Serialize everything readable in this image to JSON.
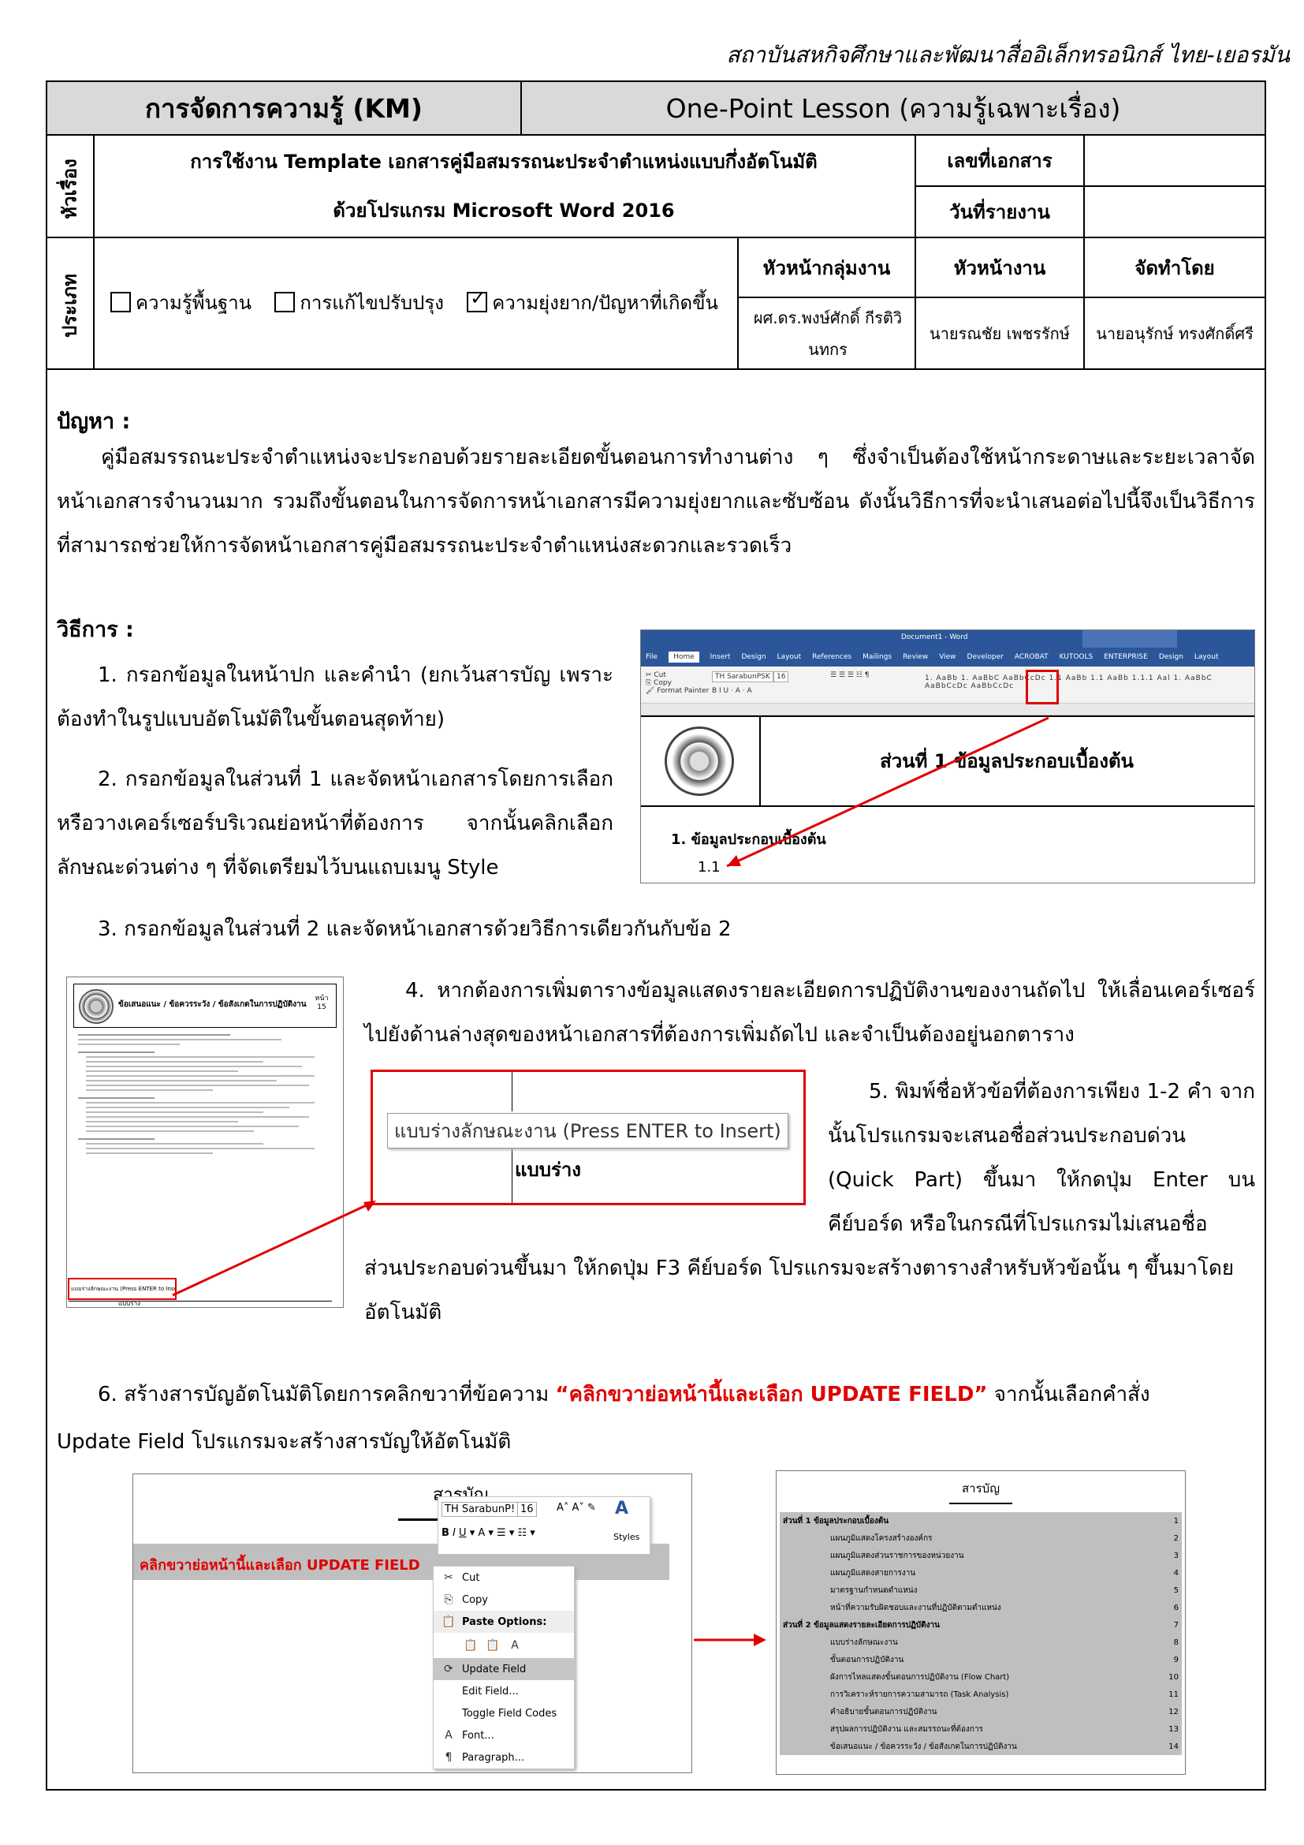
{
  "institute": "สถาบันสหกิจศึกษาและพัฒนาสื่ออิเล็กทรอนิกส์ ไทย-เยอรมัน",
  "header": {
    "km": "การจัดการความรู้ (KM)",
    "opl": "One-Point Lesson  (ความรู้เฉพาะเรื่อง)"
  },
  "topic": {
    "label": "หัวเรื่อง",
    "line1": "การใช้งาน Template เอกสารคู่มือสมรรถนะประจำตำแหน่งแบบกึ่งอัตโนมัติ",
    "line2": "ด้วยโปรแกรม Microsoft Word 2016",
    "doc_no_label": "เลขที่เอกสาร",
    "doc_no_value": "",
    "report_date_label": "วันที่รายงาน",
    "report_date_value": ""
  },
  "type": {
    "label": "ประเภท",
    "options": [
      {
        "label": "ความรู้พื้นฐาน",
        "checked": false
      },
      {
        "label": "การแก้ไขปรับปรุง",
        "checked": false
      },
      {
        "label": "ความยุ่งยาก/ปัญหาที่เกิดขึ้น",
        "checked": true
      }
    ],
    "col_heads": [
      "หัวหน้ากลุ่มงาน",
      "หัวหน้างาน",
      "จัดทำโดย"
    ],
    "names": [
      "ผศ.ดร.พงษ์ศักดิ์ กีรติวินทกร",
      "นายรณชัย เพชรรักษ์",
      "นายอนุรักษ์ ทรงศักดิ์ศรี"
    ]
  },
  "problem": {
    "heading": "ปัญหา :",
    "text": "คู่มือสมรรถนะประจำตำแหน่งจะประกอบด้วยรายละเอียดขั้นตอนการทำงานต่าง ๆ ซึ่งจำเป็นต้องใช้หน้ากระดาษและระยะเวลาจัดหน้าเอกสารจำนวนมาก รวมถึงขั้นตอนในการจัดการหน้าเอกสารมีความยุ่งยากและซับซ้อน ดังนั้นวิธีการที่จะนำเสนอต่อไปนี้จึงเป็นวิธีการที่สามารถช่วยให้การจัดหน้าเอกสารคู่มือสมรรถนะประจำตำแหน่งสะดวกและรวดเร็ว"
  },
  "method": {
    "heading": "วิธีการ :",
    "step1": "1.  กรอกข้อมูลในหน้าปก และคำนำ (ยกเว้นสารบัญ เพราะต้องทำในรูปแบบอัตโนมัติในขั้นตอนสุดท้าย)",
    "step2": "2.  กรอกข้อมูลในส่วนที่ 1 และจัดหน้าเอกสารโดยการเลือกหรือวางเคอร์เซอร์บริเวณย่อหน้าที่ต้องการ จากนั้นคลิกเลือกลักษณะด่วนต่าง ๆ ที่จัดเตรียมไว้บนแถบเมนู Style",
    "step3": "3.  กรอกข้อมูลในส่วนที่ 2 และจัดหน้าเอกสารด้วยวิธีการเดียวกันกับข้อ 2",
    "step4": "4.  หากต้องการเพิ่มตารางข้อมูลแสดงรายละเอียดการปฏิบัติงานของงานถัดไป ให้เลื่อนเคอร์เซอร์ไปยังด้านล่างสุดของหน้าเอกสารที่ต้องการเพิ่มถัดไป และจำเป็นต้องอยู่นอกตาราง",
    "step5a": "5.  พิมพ์ชื่อหัวข้อที่ต้องการเพียง 1-2 คำ จากนั้นโปรแกรมจะเสนอชื่อส่วนประกอบด่วน (Quick Part) ขึ้นมา ให้กดปุ่ม Enter บนคีย์บอร์ด หรือในกรณีที่โปรแกรมไม่เสนอชื่อ",
    "step5b": "ส่วนประกอบด่วนขึ้นมา ให้กดปุ่ม F3 คีย์บอร์ด โปรแกรมจะสร้างตารางสำหรับหัวข้อนั้น ๆ ขึ้นมาโดยอัตโนมัติ",
    "step6_pre": "6.  สร้างสารบัญอัตโนมัติโดยการคลิกขวาที่ข้อความ ",
    "step6_red": "“คลิกขวาย่อหน้านี้และเลือก UPDATE FIELD”",
    "step6_post": " จากนั้นเลือกคำสั่ง",
    "step6_line2": "Update Field โปรแกรมจะสร้างสารบัญให้อัตโนมัติ"
  },
  "shot1": {
    "title_bar": "Document1 - Word",
    "tabs": [
      "File",
      "Home",
      "Insert",
      "Design",
      "Layout",
      "References",
      "Mailings",
      "Review",
      "View",
      "Developer",
      "ACROBAT",
      "KUTOOLS",
      "ENTERPRISE",
      "Design",
      "Layout"
    ],
    "font": "TH SarabunPSK",
    "size": "16",
    "part_title": "ส่วนที่ 1  ข้อมูลประกอบเบื้องต้น",
    "heading1": "1.  ข้อมูลประกอบเบื้องต้น",
    "heading2": "1.1",
    "accent": "#e00000"
  },
  "shot2": {
    "title": "ข้อเสนอแนะ / ข้อควรระวัง / ข้อสังเกตในการปฏิบัติงาน",
    "page": "หน้า 15",
    "note": "แบบร่างลักษณะงาน (Press ENTER to Insert)",
    "typed": "แบบร่าง"
  },
  "shot3": {
    "popup": "แบบร่างลักษณะงาน  (Press ENTER to Insert)",
    "typed": "แบบร่าง"
  },
  "shot4": {
    "toc_title": "สารบัญ",
    "field_text": "คลิกขวาย่อหน้านี้และเลือก UPDATE FIELD",
    "font": "TH SarabunP!",
    "size": "16",
    "styles": "Styles",
    "menu": [
      "Cut",
      "Copy",
      "Paste Options:",
      "Update Field",
      "Edit Field...",
      "Toggle Field Codes",
      "Font...",
      "Paragraph..."
    ]
  },
  "shot5": {
    "toc_title": "สารบัญ",
    "rows": [
      {
        "t": "ส่วนที่ 1 ข้อมูลประกอบเบื้องต้น",
        "p": "1",
        "b": true
      },
      {
        "t": "แผนภูมิแสดงโครงสร้างองค์กร",
        "p": "2",
        "b": false
      },
      {
        "t": "แผนภูมิแสดงส่วนราชการของหน่วยงาน",
        "p": "3",
        "b": false
      },
      {
        "t": "แผนภูมิแสดงสายการงาน",
        "p": "4",
        "b": false
      },
      {
        "t": "มาตรฐานกำหนดตำแหน่ง",
        "p": "5",
        "b": false
      },
      {
        "t": "หน้าที่ความรับผิดชอบและงานที่ปฏิบัติตามตำแหน่ง",
        "p": "6",
        "b": false
      },
      {
        "t": "ส่วนที่ 2 ข้อมูลแสดงรายละเอียดการปฏิบัติงาน",
        "p": "7",
        "b": true
      },
      {
        "t": "แบบร่างลักษณะงาน",
        "p": "8",
        "b": false
      },
      {
        "t": "ขั้นตอนการปฏิบัติงาน",
        "p": "9",
        "b": false
      },
      {
        "t": "ผังการไหลแสดงขั้นตอนการปฏิบัติงาน (Flow Chart)",
        "p": "10",
        "b": false
      },
      {
        "t": "การวิเคราะห์รายการความสามารถ (Task Analysis)",
        "p": "11",
        "b": false
      },
      {
        "t": "คำอธิบายขั้นตอนการปฏิบัติงาน",
        "p": "12",
        "b": false
      },
      {
        "t": "สรุปผลการปฏิบัติงาน และสมรรถนะที่ต้องการ",
        "p": "13",
        "b": false
      },
      {
        "t": "ข้อเสนอแนะ / ข้อควรระวัง / ข้อสังเกตในการปฏิบัติงาน",
        "p": "14",
        "b": false
      }
    ]
  }
}
